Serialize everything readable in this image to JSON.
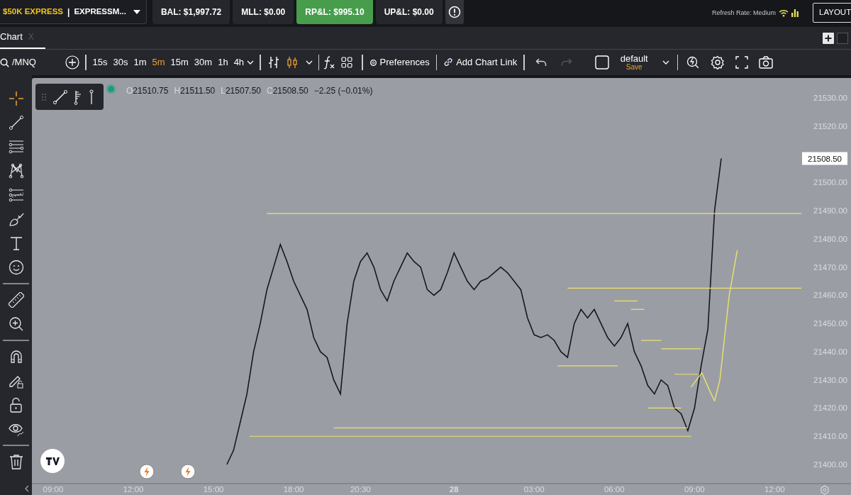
{
  "account": {
    "name": "$50K EXPRESS",
    "separator": "|",
    "detail": "EXPRESSM..."
  },
  "stats": [
    {
      "label": "BAL: $1,997.72",
      "kind": "plain"
    },
    {
      "label": "MLL: $0.00",
      "kind": "plain"
    },
    {
      "label": "RP&L: $995.10",
      "kind": "positive"
    },
    {
      "label": "UP&L: $0.00",
      "kind": "plain"
    }
  ],
  "refresh_rate": "Refresh Rate: Medium",
  "layout_button": "LAYOUT",
  "tabs": [
    {
      "label": "Chart",
      "close": "X",
      "selected": true
    }
  ],
  "symbol": "/MNQ",
  "timeframes": [
    {
      "label": "15s",
      "selected": false
    },
    {
      "label": "30s",
      "selected": false
    },
    {
      "label": "1m",
      "selected": false
    },
    {
      "label": "5m",
      "selected": true
    },
    {
      "label": "15m",
      "selected": false
    },
    {
      "label": "30m",
      "selected": false
    },
    {
      "label": "1h",
      "selected": false
    },
    {
      "label": "4h",
      "selected": false
    }
  ],
  "chart_types": [
    {
      "kind": "bars",
      "selected": false
    },
    {
      "kind": "candles",
      "selected": true
    }
  ],
  "preferences": "Preferences",
  "add_link": "Add Chart Link",
  "undo": {
    "disabled": false
  },
  "redo": {
    "disabled": true
  },
  "layout": {
    "name": "default",
    "action": "Save"
  },
  "tool_groups": [
    [
      {
        "kind": "crosshair",
        "selected": true
      },
      {
        "kind": "line",
        "selected": false
      },
      {
        "kind": "hlines",
        "selected": false
      },
      {
        "kind": "pattern",
        "selected": false
      },
      {
        "kind": "channel",
        "selected": false
      },
      {
        "kind": "brush",
        "selected": false
      },
      {
        "kind": "text",
        "selected": false
      },
      {
        "kind": "emoji",
        "selected": false
      }
    ],
    [
      {
        "kind": "ruler",
        "selected": false
      },
      {
        "kind": "zoom",
        "selected": false
      }
    ],
    [
      {
        "kind": "magnet",
        "selected": false
      },
      {
        "kind": "pencil-lock",
        "selected": false
      },
      {
        "kind": "lock",
        "selected": false
      },
      {
        "kind": "eye",
        "selected": false
      }
    ],
    [
      {
        "kind": "trash",
        "selected": false
      }
    ]
  ],
  "market_open": true,
  "legend": {
    "open_label": "O",
    "open": "21510.75",
    "high_label": "H",
    "high": "21511.50",
    "low_label": "L",
    "low": "21507.50",
    "close_label": "C",
    "close": "21508.50",
    "change": "−2.25 (−0.01%)"
  },
  "last_price": "21508.50",
  "chart_data": {
    "type": "line",
    "ylim": [
      21400,
      21530
    ],
    "yticks": [
      {
        "value": 21400,
        "label": "21400.00"
      },
      {
        "value": 21410,
        "label": "21410.00"
      },
      {
        "value": 21420,
        "label": "21420.00"
      },
      {
        "value": 21430,
        "label": "21430.00"
      },
      {
        "value": 21440,
        "label": "21440.00"
      },
      {
        "value": 21450,
        "label": "21450.00"
      },
      {
        "value": 21460,
        "label": "21460.00"
      },
      {
        "value": 21470,
        "label": "21470.00"
      },
      {
        "value": 21480,
        "label": "21480.00"
      },
      {
        "value": 21490,
        "label": "21490.00"
      },
      {
        "value": 21500,
        "label": "21500.00"
      },
      {
        "value": 21520,
        "label": "21520.00"
      },
      {
        "value": 21530,
        "label": "21530.00"
      }
    ],
    "categories": [
      "09:00",
      null,
      null,
      null,
      null,
      null,
      null,
      null,
      null,
      null,
      null,
      null,
      "12:00",
      null,
      null,
      null,
      null,
      null,
      null,
      null,
      null,
      null,
      null,
      null,
      "15:00",
      null,
      null,
      null,
      null,
      null,
      null,
      null,
      null,
      null,
      null,
      null,
      "18:00",
      null,
      null,
      null,
      null,
      null,
      null,
      null,
      null,
      null,
      "20:30",
      null,
      null,
      null,
      null,
      null,
      null,
      null,
      null,
      null,
      null,
      null,
      null,
      null,
      "28",
      null,
      null,
      null,
      null,
      null,
      null,
      null,
      null,
      null,
      null,
      null,
      "03:00",
      null,
      null,
      null,
      null,
      null,
      null,
      null,
      null,
      null,
      null,
      null,
      "06:00",
      null,
      null,
      null,
      null,
      null,
      null,
      null,
      null,
      null,
      null,
      null,
      "09:00",
      null,
      null,
      null,
      null,
      null,
      null,
      null,
      null,
      null,
      null,
      null,
      "12:00"
    ],
    "series": [
      {
        "color": "#17181c",
        "values": [
          null,
          null,
          null,
          null,
          null,
          null,
          null,
          null,
          null,
          null,
          null,
          null,
          null,
          null,
          null,
          null,
          null,
          null,
          null,
          null,
          null,
          null,
          null,
          null,
          null,
          null,
          21400,
          21405,
          21415,
          21425,
          21440,
          21450,
          21462,
          21470,
          21478,
          21472,
          21465,
          21460,
          21455,
          21445,
          21440,
          21438,
          21430,
          21425,
          21450,
          21465,
          21472,
          21475,
          21470,
          21462,
          21458,
          21465,
          21470,
          21475,
          21472,
          21470,
          21462,
          21460,
          21462,
          21468,
          21475,
          21470,
          21465,
          21462,
          21465,
          21466,
          21468,
          21470,
          21468,
          21465,
          21462,
          21452,
          21446,
          21445,
          21446,
          21444,
          21440,
          21438,
          21450,
          21455,
          21452,
          21455,
          21450,
          21445,
          21442,
          21445,
          21450,
          21440,
          21435,
          21428,
          21425,
          21430,
          21428,
          21420,
          21418,
          21412,
          21420,
          21435,
          21448,
          21490,
          21508.5,
          null,
          null,
          null,
          null,
          null,
          null,
          null,
          null
        ]
      }
    ]
  }
}
